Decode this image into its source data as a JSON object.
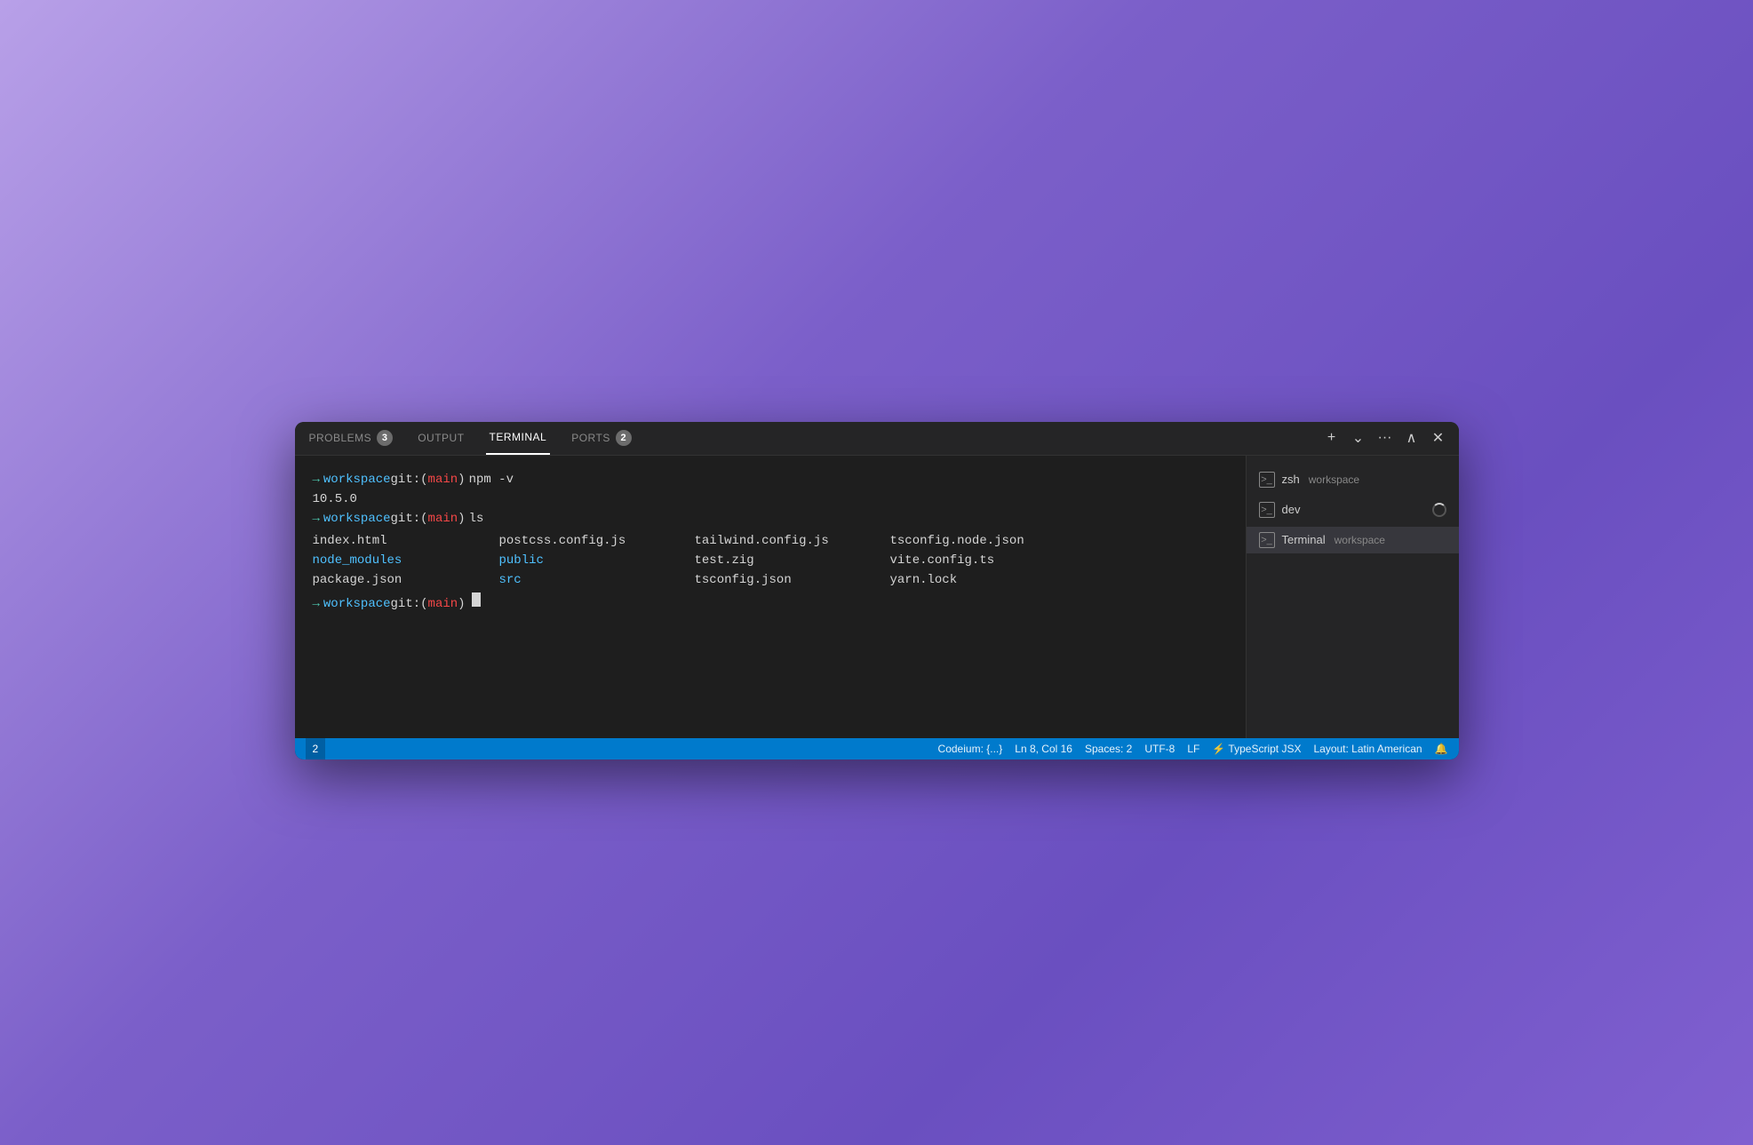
{
  "tabs": {
    "items": [
      {
        "id": "problems",
        "label": "PROBLEMS",
        "badge": "3",
        "active": false
      },
      {
        "id": "output",
        "label": "OUTPUT",
        "badge": null,
        "active": false
      },
      {
        "id": "terminal",
        "label": "TERMINAL",
        "badge": null,
        "active": true
      },
      {
        "id": "ports",
        "label": "PORTS",
        "badge": "2",
        "active": false
      }
    ],
    "actions": {
      "add": "+",
      "dropdown": "⌄",
      "more": "···",
      "collapse": "∧",
      "close": "✕"
    }
  },
  "terminal": {
    "lines": [
      {
        "type": "prompt_command",
        "command": "npm -v"
      },
      {
        "type": "output",
        "text": "10.5.0"
      },
      {
        "type": "prompt_command",
        "command": "ls"
      },
      {
        "type": "files",
        "col1": [
          "index.html",
          "node_modules",
          "package.json"
        ],
        "col2": [
          "postcss.config.js",
          "public",
          "src"
        ],
        "col3": [
          "tailwind.config.js",
          "test.zig",
          "tsconfig.json"
        ],
        "col4": [
          "tsconfig.node.json",
          "vite.config.ts",
          "yarn.lock"
        ]
      },
      {
        "type": "prompt_cursor"
      }
    ],
    "prompt": {
      "arrow": "→",
      "workspace": "workspace",
      "git_prefix": "git:(",
      "branch": "main",
      "git_suffix": ")"
    }
  },
  "sidebar": {
    "items": [
      {
        "id": "zsh",
        "icon": ">_",
        "name": "zsh",
        "sub": "workspace",
        "loading": false,
        "active": false
      },
      {
        "id": "dev",
        "icon": ">_",
        "name": "dev",
        "sub": "",
        "loading": true,
        "active": false
      },
      {
        "id": "terminal-workspace",
        "icon": ">_",
        "name": "Terminal",
        "sub": "workspace",
        "loading": false,
        "active": true
      }
    ]
  },
  "statusbar": {
    "left_number": "2",
    "items": [
      {
        "id": "codeium",
        "label": "Codeium: {...}"
      },
      {
        "id": "position",
        "label": "Ln 8, Col 16"
      },
      {
        "id": "spaces",
        "label": "Spaces: 2"
      },
      {
        "id": "encoding",
        "label": "UTF-8"
      },
      {
        "id": "eol",
        "label": "LF"
      },
      {
        "id": "language",
        "label": "⚡ TypeScript JSX"
      },
      {
        "id": "layout",
        "label": "Layout: Latin American"
      },
      {
        "id": "bell",
        "label": "🔔"
      }
    ]
  }
}
